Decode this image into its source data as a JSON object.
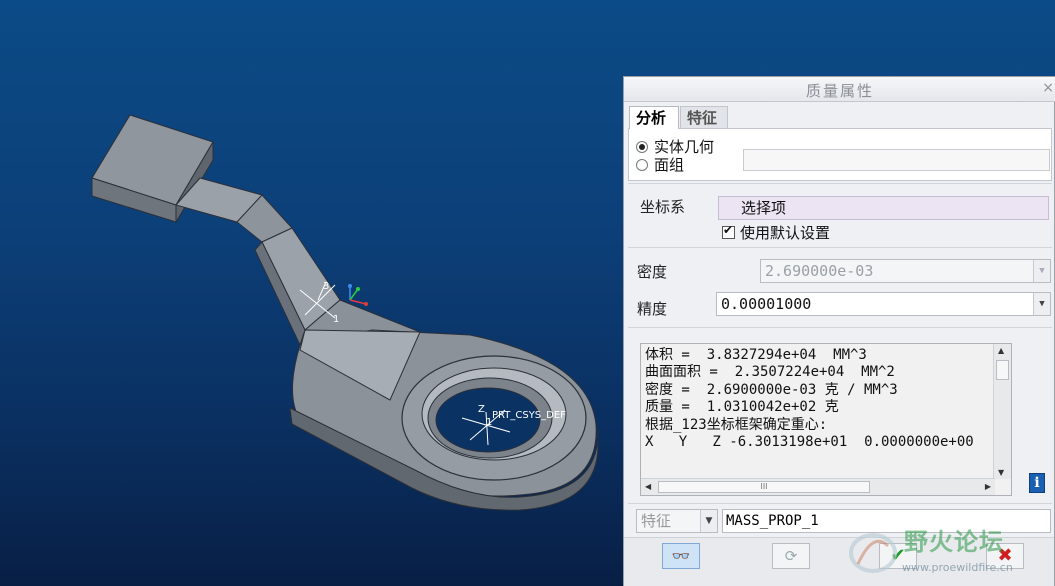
{
  "dialog": {
    "title": "质量属性",
    "close_glyph": "×",
    "tabs": [
      {
        "label": "分析",
        "active": true
      },
      {
        "label": "特征",
        "active": false
      }
    ],
    "geometry_options": [
      {
        "label": "实体几何",
        "selected": true
      },
      {
        "label": "面组",
        "selected": false
      }
    ],
    "coordinate_system": {
      "label": "坐标系",
      "select_placeholder": "选择项",
      "use_default_label": "使用默认设置",
      "use_default_checked": true
    },
    "density": {
      "label": "密度",
      "value": "2.690000e-03"
    },
    "precision": {
      "label": "精度",
      "value": "0.00001000"
    },
    "results": {
      "lines": [
        "体积 =  3.8327294e+04  MM^3",
        "曲面面积 =  2.3507224e+04  MM^2",
        "密度 =  2.6900000e-03 克 / MM^3",
        "质量 =  1.0310042e+02 克",
        "",
        "根据_123坐标框架确定重心:",
        "X   Y   Z -6.3013198e+01  0.0000000e+00"
      ],
      "hscroll_thumb": "III"
    },
    "info_glyph": "i",
    "feature": {
      "type_label": "特征",
      "name": "MASS_PROP_1"
    },
    "buttons": {
      "preview_glyph": "👓",
      "recalc_glyph": "⟳",
      "ok_glyph": "✔",
      "cancel_glyph": "✖"
    }
  },
  "viewport": {
    "csys_label": "PRT_CSYS_DEF",
    "csys_axis_labels": {
      "x": "1",
      "y": "2",
      "z": "3"
    },
    "csys_small_labels": {
      "a": "Z",
      "b": "1"
    }
  },
  "watermark": {
    "title": "野火论坛",
    "url": "www.proewildfire.cn"
  },
  "colors": {
    "viewport_top": "#0b4b86",
    "viewport_bottom": "#081f45",
    "part_gray": "#8e949c",
    "accent_blue": "#1b5fb3"
  }
}
